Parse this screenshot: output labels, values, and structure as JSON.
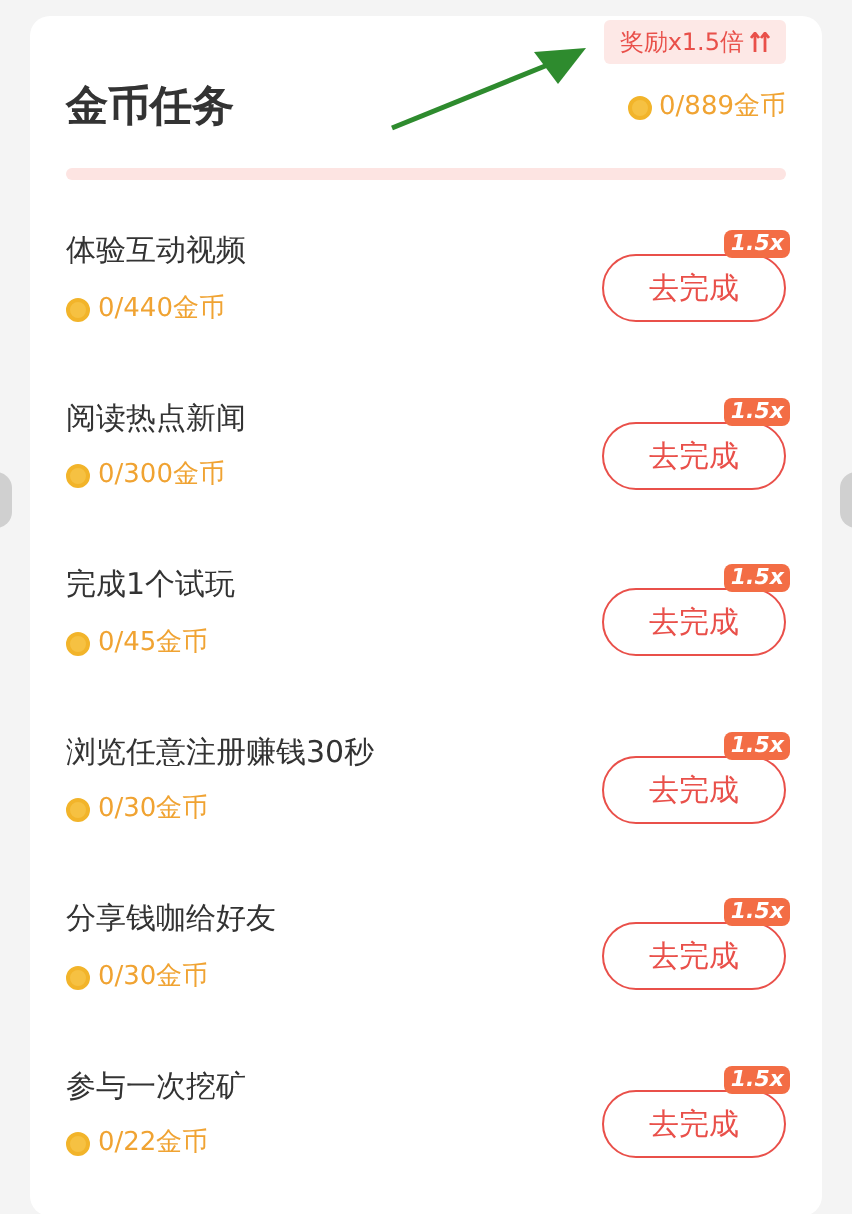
{
  "header": {
    "title": "金币任务",
    "bonus_badge": "奖励x1.5倍",
    "total": "0/889金币",
    "progress": {
      "level": 0
    }
  },
  "tasks": [
    {
      "title": "体验互动视频",
      "reward": "0/440金币",
      "button": "去完成",
      "multiplier": "1.5x"
    },
    {
      "title": "阅读热点新闻",
      "reward": "0/300金币",
      "button": "去完成",
      "multiplier": "1.5x"
    },
    {
      "title": "完成1个试玩",
      "reward": "0/45金币",
      "button": "去完成",
      "multiplier": "1.5x"
    },
    {
      "title": "浏览任意注册赚钱30秒",
      "reward": "0/30金币",
      "button": "去完成",
      "multiplier": "1.5x"
    },
    {
      "title": "分享钱咖给好友",
      "reward": "0/30金币",
      "button": "去完成",
      "multiplier": "1.5x"
    },
    {
      "title": "参与一次挖矿",
      "reward": "0/22金币",
      "button": "去完成",
      "multiplier": "1.5x"
    }
  ]
}
